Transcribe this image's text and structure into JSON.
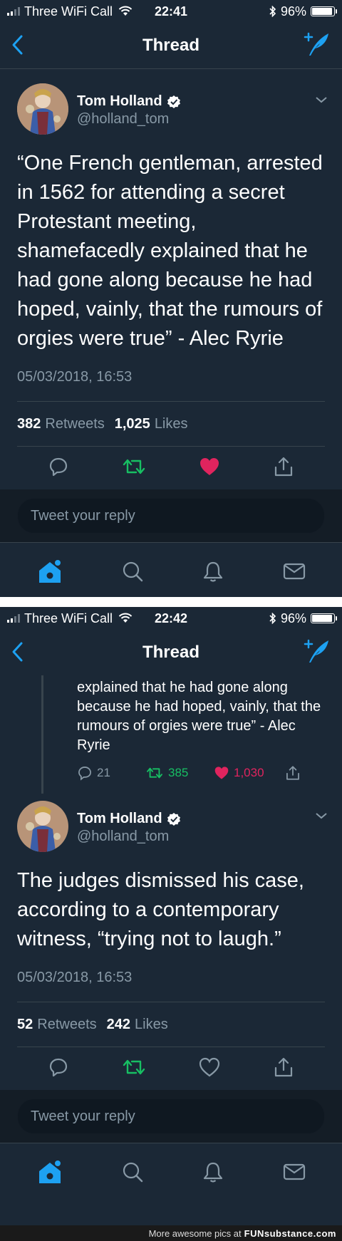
{
  "status1": {
    "carrier": "Three WiFi Call",
    "time": "22:41",
    "battery": "96%",
    "battery_fraction": 0.96
  },
  "status2": {
    "carrier": "Three WiFi Call",
    "time": "22:42",
    "battery": "96%",
    "battery_fraction": 0.96
  },
  "nav": {
    "title": "Thread"
  },
  "tweet1": {
    "author_name": "Tom Holland",
    "author_handle": "@holland_tom",
    "text": "“One French gentleman, arrested in 1562 for attending a secret Protestant meeting, shamefacedly explained that he had gone along because he had hoped, vainly, that the rumours of orgies were true” - Alec Ryrie",
    "timestamp": "05/03/2018, 16:53",
    "retweets_count": "382",
    "retweets_label": "Retweets",
    "likes_count": "1,025",
    "likes_label": "Likes",
    "liked": true
  },
  "reply_placeholder": "Tweet your reply",
  "parent_excerpt": {
    "text": "explained that he had gone along because he had hoped, vainly, that the rumours of orgies were true” - Alec Ryrie",
    "replies": "21",
    "retweets": "385",
    "likes": "1,030"
  },
  "tweet2": {
    "author_name": "Tom Holland",
    "author_handle": "@holland_tom",
    "text": "The judges dismissed his case, according to a contemporary witness, “trying not to laugh.”",
    "timestamp": "05/03/2018, 16:53",
    "retweets_count": "52",
    "retweets_label": "Retweets",
    "likes_count": "242",
    "likes_label": "Likes",
    "liked": false
  },
  "footer": {
    "text": "More awesome pics at",
    "brand": "FUNsubstance.com"
  },
  "colors": {
    "background": "#1b2836",
    "accent": "#1da1f2",
    "retweet": "#17bf63",
    "like": "#e0245e",
    "secondary_text": "#8899a6"
  },
  "icons": [
    "back-arrow-icon",
    "compose-tweet-icon",
    "verified-badge-icon",
    "chevron-down-icon",
    "reply-icon",
    "retweet-icon",
    "heart-icon",
    "share-icon",
    "home-icon",
    "search-icon",
    "notifications-icon",
    "messages-icon",
    "wifi-icon",
    "bluetooth-icon",
    "battery-icon",
    "signal-icon"
  ]
}
